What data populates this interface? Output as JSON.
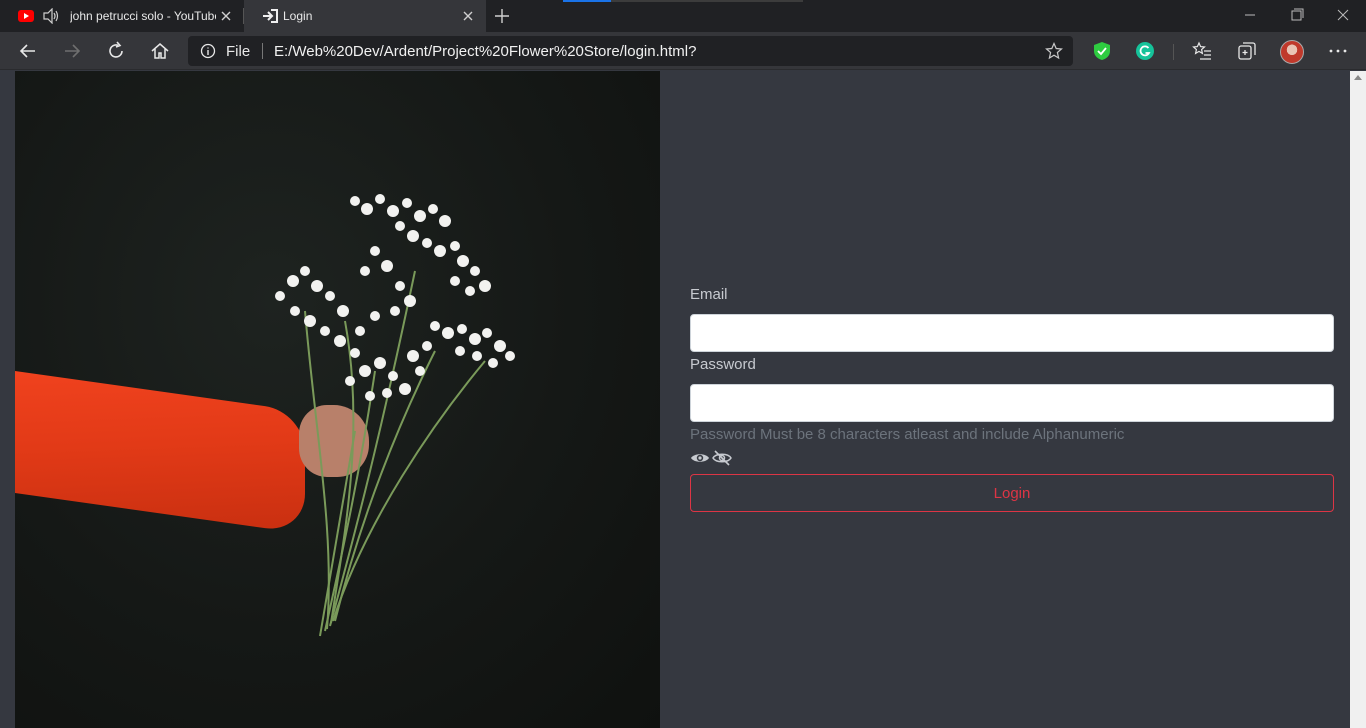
{
  "browser": {
    "tabs": [
      {
        "title": "john petrucci solo - YouTube",
        "icon": "youtube-icon",
        "audio": true
      },
      {
        "title": "Login",
        "icon": "login-icon",
        "active": true
      }
    ],
    "address": {
      "scheme_label": "File",
      "url": "E:/Web%20Dev/Ardent/Project%20Flower%20Store/login.html?"
    },
    "colors": {
      "tabstrip": "#202124",
      "toolbar": "#35363a",
      "addressbar": "#202124"
    }
  },
  "login_form": {
    "email_label": "Email",
    "email_value": "",
    "password_label": "Password",
    "password_value": "",
    "password_hint": "Password Must be 8 characters atleast and include Alphanumeric",
    "login_button": "Login"
  },
  "colors": {
    "page_bg": "#353840",
    "label": "#c7cad0",
    "hint": "#6c737c",
    "danger": "#dc3545"
  }
}
